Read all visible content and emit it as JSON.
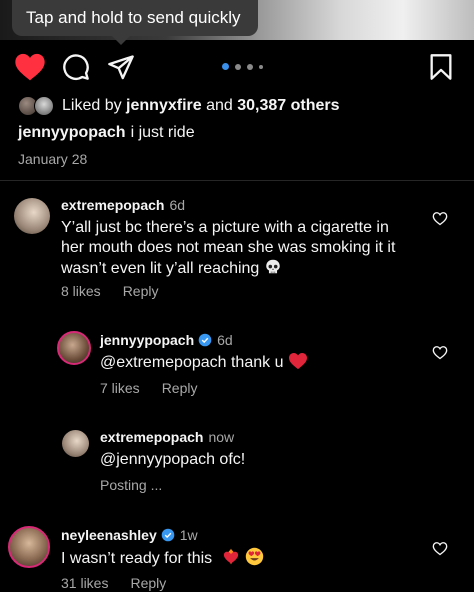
{
  "tooltip": {
    "text": "Tap and hold to send quickly"
  },
  "carousel": {
    "active_index": 0,
    "count": 4
  },
  "likes": {
    "prefix": "Liked by ",
    "user": "jennyxfire",
    "middle": " and ",
    "count": "30,387 others"
  },
  "caption": {
    "username": "jennyypopach",
    "text": "i just ride"
  },
  "post_date": "January 28",
  "comments": [
    {
      "username": "extremepopach",
      "time": "6d",
      "text": "Y’all just bc there’s a picture with a cigarette in her mouth does not mean she was smoking it it wasn’t even lit y’all reaching",
      "emoji": "skull",
      "likes": "8 likes",
      "reply": "Reply"
    },
    {
      "username": "jennyypopach",
      "verified": true,
      "time": "6d",
      "text": "@extremepopach thank u",
      "emoji": "red-heart",
      "likes": "7 likes",
      "reply": "Reply"
    },
    {
      "username": "extremepopach",
      "time": "now",
      "text": "@jennyypopach ofc!",
      "status": "Posting ..."
    },
    {
      "username": "neyleenashley",
      "verified": true,
      "time": "1w",
      "text": "I wasn’t ready for this",
      "emoji": "heart-on-fire, heart-eyes",
      "likes": "31 likes",
      "reply": "Reply"
    }
  ],
  "colors": {
    "like_active": "#ff3040",
    "verified": "#3897f0",
    "secondary_text": "#a8a8a8",
    "tooltip_bg": "#3a3a3a"
  }
}
